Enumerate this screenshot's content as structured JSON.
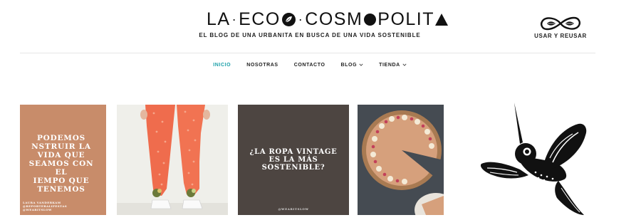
{
  "header": {
    "logo_parts": [
      "LA",
      "ECO",
      "COSM",
      "POLIT"
    ],
    "tagline": "EL BLOG DE UNA URBANITA EN BUSCA DE UNA VIDA SOSTENIBLE",
    "brand_icon": "infinity-leaf-icon",
    "brand_label": "USAR Y REUSAR"
  },
  "nav": {
    "items": [
      {
        "label": "INICIO",
        "active": true,
        "dropdown": false
      },
      {
        "label": "NOSOTRAS",
        "active": false,
        "dropdown": false
      },
      {
        "label": "CONTACTO",
        "active": false,
        "dropdown": false
      },
      {
        "label": "BLOG",
        "active": false,
        "dropdown": true
      },
      {
        "label": "TIENDA",
        "active": false,
        "dropdown": true
      }
    ],
    "active_color": "#1a9fa8"
  },
  "posts": [
    {
      "quote_lines": [
        "PODEMOS",
        "NSTRUIR LA",
        "VIDA QUE",
        "SEAMOS CON",
        "EL",
        "IEMPO QUE",
        "TENEMOS"
      ],
      "author_lines": [
        "LAURA VANDERKAM",
        "@REPORTERALIFESTAS",
        "@WEARITSLOW"
      ],
      "background": "#c88c6a"
    },
    {
      "image": "orange-floral-pants-photo",
      "background": "#eeeee9"
    },
    {
      "quote_lines": [
        "¿LA ROPA VINTAGE",
        "ES LA MÁS",
        "SOSTENIBLE?"
      ],
      "handle": "@WEARITSLOW",
      "background": "#4d4541"
    },
    {
      "image": "tart-dessert-photo",
      "background": "#4a4f55"
    }
  ],
  "sidebar": {
    "image": "hummingbird-illustration-icon"
  }
}
